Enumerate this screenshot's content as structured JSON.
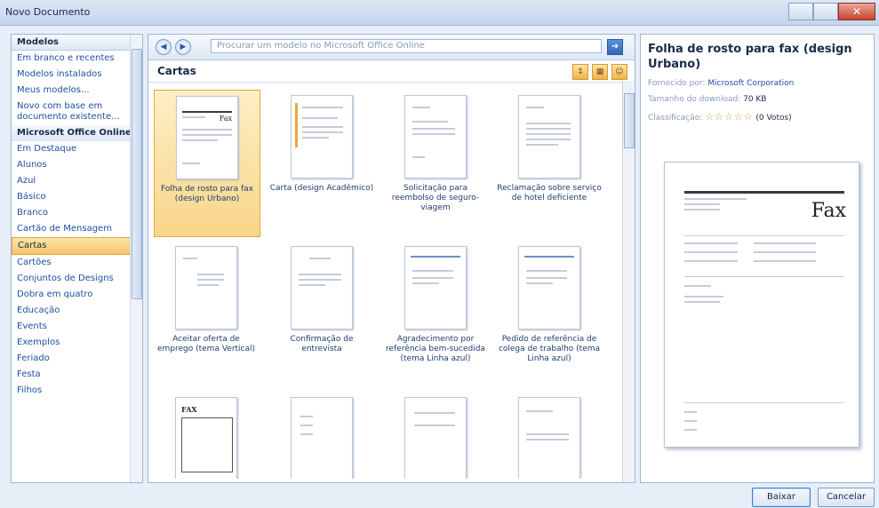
{
  "window": {
    "title": "Novo Documento"
  },
  "sidebar": {
    "header": "Modelos",
    "items": [
      {
        "label": "Em branco e recentes"
      },
      {
        "label": "Modelos instalados"
      },
      {
        "label": "Meus modelos..."
      },
      {
        "label": "Novo com base em documento existente..."
      },
      {
        "label": "Microsoft Office Online"
      },
      {
        "label": "Em Destaque"
      },
      {
        "label": "Alunos"
      },
      {
        "label": "Azul"
      },
      {
        "label": "Básico"
      },
      {
        "label": "Branco"
      },
      {
        "label": "Cartão de Mensagem"
      },
      {
        "label": "Cartas"
      },
      {
        "label": "Cartões"
      },
      {
        "label": "Conjuntos de Designs"
      },
      {
        "label": "Dobra em quatro"
      },
      {
        "label": "Educação"
      },
      {
        "label": "Events"
      },
      {
        "label": "Exemplos"
      },
      {
        "label": "Feriado"
      },
      {
        "label": "Festa"
      },
      {
        "label": "Filhos"
      }
    ]
  },
  "search": {
    "placeholder": "Procurar um modelo no Microsoft Office Online"
  },
  "section": {
    "title": "Cartas"
  },
  "templates": [
    {
      "label": "Folha de rosto para fax (design Urbano)"
    },
    {
      "label": "Carta (design Acadêmico)"
    },
    {
      "label": "Solicitação para reembolso de seguro-viagem"
    },
    {
      "label": "Reclamação sobre serviço de hotel deficiente"
    },
    {
      "label": "Aceitar oferta de emprego (tema Vertical)"
    },
    {
      "label": "Confirmação de entrevista"
    },
    {
      "label": "Agradecimento por referência bem-sucedida (tema Linha azul)"
    },
    {
      "label": "Pedido de referência de colega de trabalho (tema Linha azul)"
    },
    {
      "label": ""
    },
    {
      "label": ""
    },
    {
      "label": ""
    },
    {
      "label": ""
    }
  ],
  "thumb_text": {
    "fax": "Fax",
    "fax_caps": "FAX"
  },
  "details": {
    "title": "Folha de rosto para fax (design Urbano)",
    "provided_label": "Fornecido por:",
    "provided_value": "Microsoft Corporation",
    "size_label": "Tamanho do download:",
    "size_value": "70 KB",
    "rating_label": "Classificação:",
    "rating_value": "(0 Votos)",
    "rating_stars": 0,
    "preview_fax": "Fax"
  },
  "buttons": {
    "download": "Baixar",
    "cancel": "Cancelar"
  }
}
